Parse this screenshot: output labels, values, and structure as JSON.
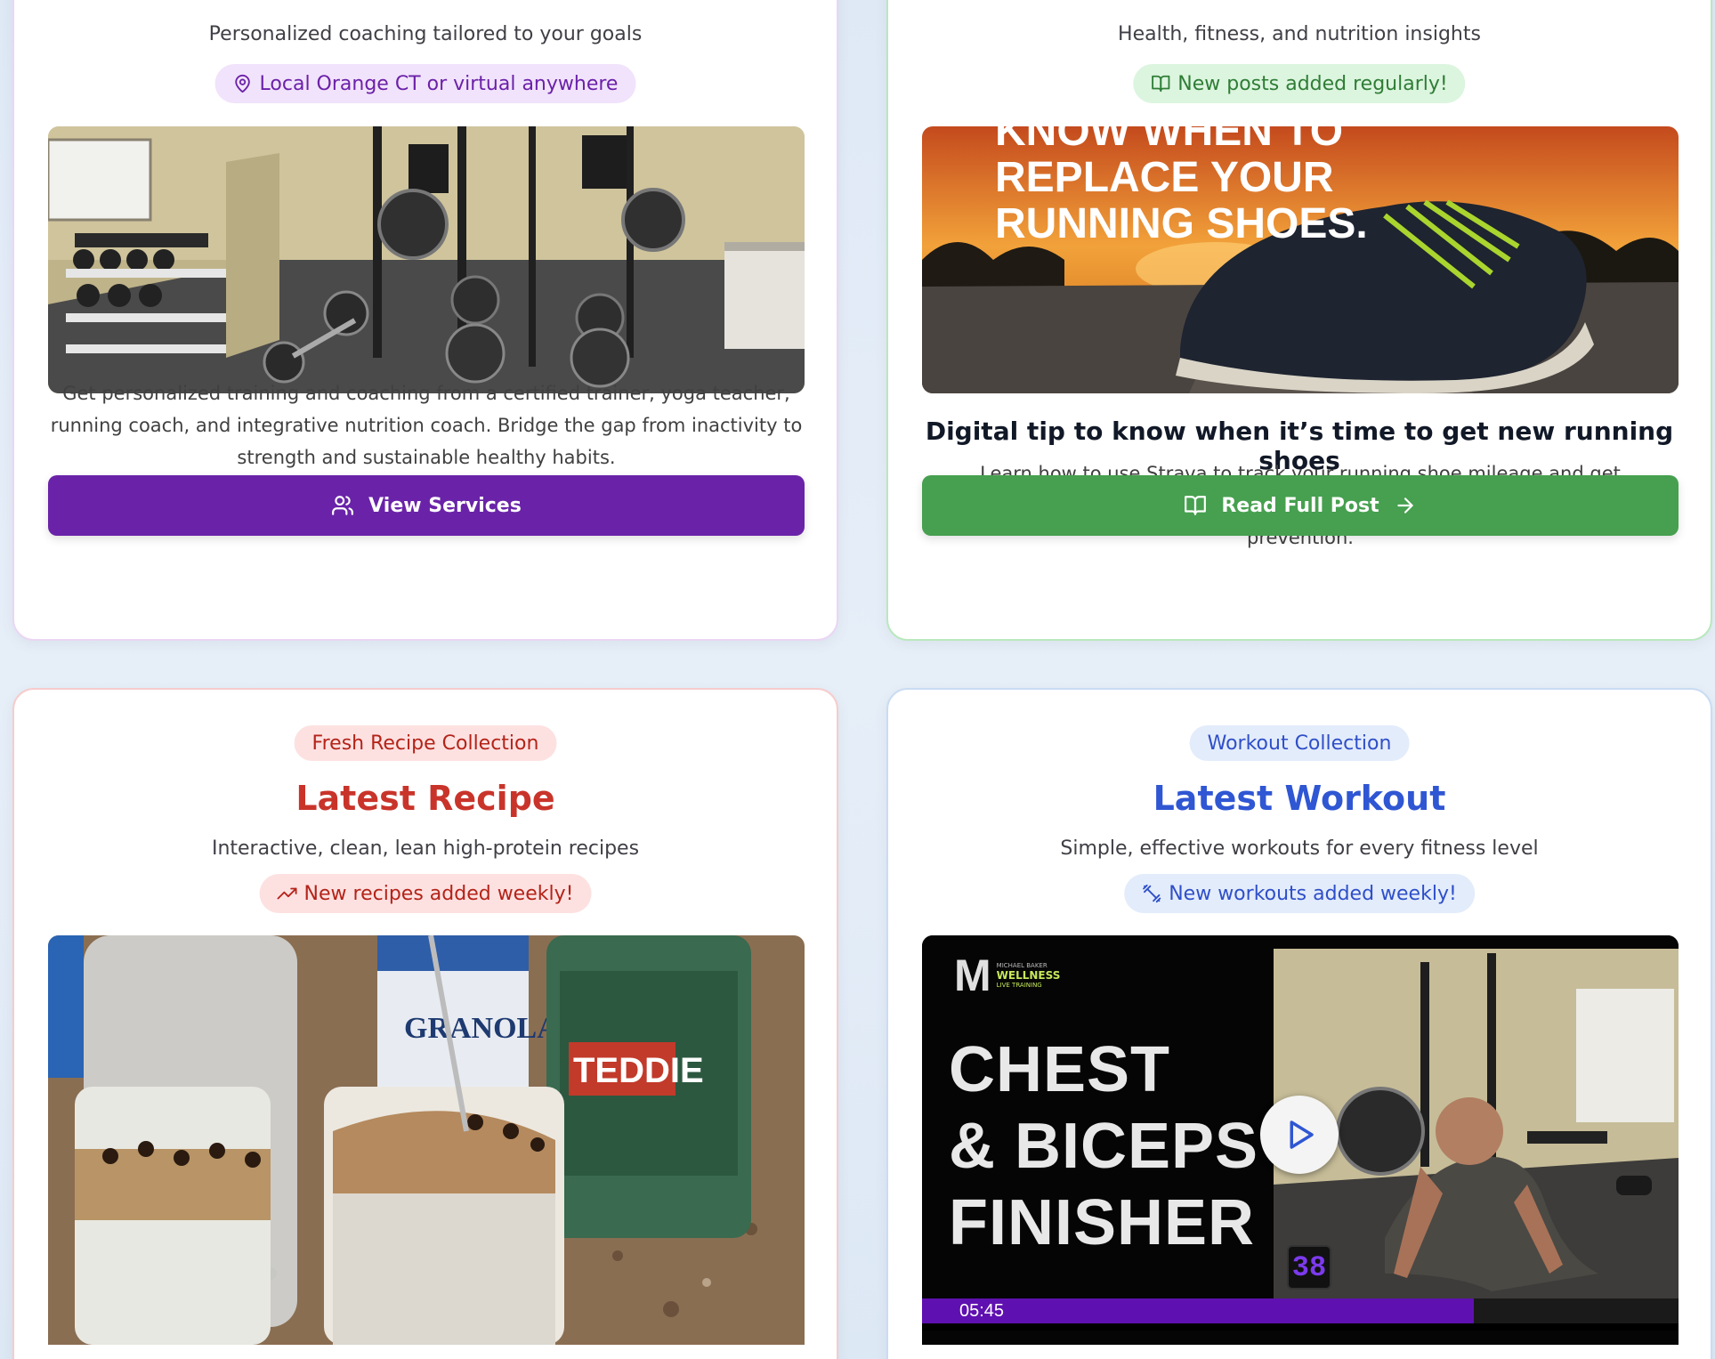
{
  "colors": {
    "purple": "#6a23a8",
    "green": "#46a04f",
    "red": "#c9342a",
    "blue": "#2f56d3"
  },
  "services": {
    "subtitle": "Personalized coaching tailored to your goals",
    "badge": "Local Orange CT or virtual anywhere",
    "badge_icon": "map-pin-icon",
    "image_alt": "home gym",
    "description": "Get personalized training and coaching from a certified trainer, yoga teacher, running coach, and integrative nutrition coach. Bridge the gap from inactivity to strength and sustainable healthy habits.",
    "button_label": "View Services",
    "button_icon": "users-icon"
  },
  "blog": {
    "subtitle": "Health, fitness, and nutrition insights",
    "badge": "New posts added regularly!",
    "badge_icon": "book-open-icon",
    "image_text_line1": "KNOW WHEN TO",
    "image_text_line2": "REPLACE YOUR",
    "image_text_line3": "RUNNING SHOES.",
    "post_title": "Digital tip to know when it’s time to get new running shoes",
    "post_excerpt": "Learn how to use Strava to track your running shoe mileage and get notifications when it’s time to replace them for optimal performance and injury prevention.",
    "button_label": "Read Full Post",
    "button_icon": "book-open-icon",
    "button_trailing_icon": "arrow-right-icon"
  },
  "recipe": {
    "tag": "Fresh Recipe Collection",
    "title": "Latest Recipe",
    "subtitle": "Interactive, clean, lean high-protein recipes",
    "badge": "New recipes added weekly!",
    "badge_icon": "trending-up-icon",
    "jar_brand": "TEDDIE",
    "granola_label": "GRANOLA"
  },
  "workout": {
    "tag": "Workout Collection",
    "title": "Latest Workout",
    "subtitle": "Simple, effective workouts for every fitness level",
    "badge": "New workouts added weekly!",
    "badge_icon": "dumbbell-icon",
    "video": {
      "brand_letter": "M",
      "brand_small": "MICHAEL BAKER",
      "brand_name": "WELLNESS",
      "brand_sub": "LIVE TRAINING",
      "title_line1": "CHEST",
      "title_line2": "& BICEPS",
      "title_line3": "FINISHER",
      "counter": "38",
      "timestamp": "05:45",
      "progress": 0.73
    }
  }
}
